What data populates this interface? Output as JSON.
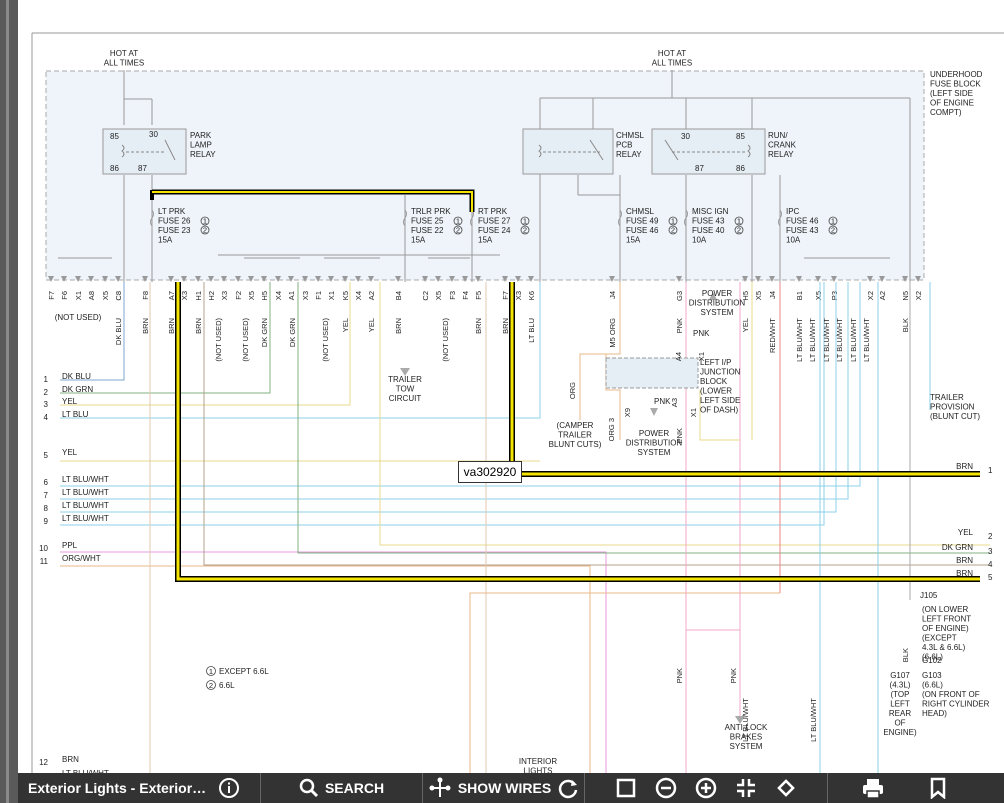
{
  "toolbar": {
    "title": "Exterior Lights - Exterior La...",
    "info_icon": "info-icon",
    "search_label": "SEARCH",
    "show_wires_label": "SHOW WIRES",
    "icons": [
      "search-icon",
      "wires-icon",
      "refresh-icon",
      "fit-icon",
      "zoom-out-icon",
      "zoom-in-icon",
      "collapse-icon",
      "rotate-icon",
      "print-icon",
      "bookmark-icon"
    ]
  },
  "callout": "va302920",
  "diagram": {
    "hot_left": "HOT AT\nALL TIMES",
    "hot_right": "HOT AT\nALL TIMES",
    "fuse_block": "UNDERHOOD\nFUSE BLOCK\n(LEFT SIDE\nOF ENGINE\nCOMPT)",
    "park_relay": "PARK\nLAMP\nRELAY",
    "chmsl_relay": "CHMSL\nPCB\nRELAY",
    "run_relay": "RUN/\nCRANK\nRELAY",
    "relay_pins_left": [
      "85",
      "30",
      "86",
      "87"
    ],
    "relay_pins_right": [
      "30",
      "85",
      "87",
      "86"
    ],
    "fuses": [
      {
        "name": "LT PRK",
        "a": "FUSE 26",
        "b": "FUSE 23",
        "amp": "15A"
      },
      {
        "name": "TRLR PRK",
        "a": "FUSE 25",
        "b": "FUSE 22",
        "amp": "15A"
      },
      {
        "name": "RT PRK",
        "a": "FUSE 27",
        "b": "FUSE 24",
        "amp": "15A"
      },
      {
        "name": "CHMSL",
        "a": "FUSE 49",
        "b": "FUSE 46",
        "amp": "15A"
      },
      {
        "name": "MISC IGN",
        "a": "FUSE 43",
        "b": "FUSE 40",
        "amp": "10A"
      },
      {
        "name": "IPC",
        "a": "FUSE 46",
        "b": "FUSE 43",
        "amp": "10A"
      }
    ],
    "pins": [
      "F7",
      "F6",
      "X1",
      "A8",
      "X5",
      "C8",
      "F8",
      "A7",
      "X3",
      "H1",
      "H2",
      "X3",
      "F2",
      "X5",
      "H5",
      "X4",
      "A1",
      "X3",
      "F1",
      "X1",
      "K5",
      "X4",
      "A2",
      "B4",
      "C2",
      "X5",
      "F3",
      "F4",
      "F5",
      "F7",
      "X3",
      "K6",
      "J4",
      "G3",
      "H5",
      "X5",
      "J4",
      "B1",
      "X5",
      "P3",
      "X2",
      "A2",
      "N5",
      "X2"
    ],
    "wire_colors_top": [
      "DK BLU",
      "BRN",
      "BRN",
      "BRN",
      "(NOT USED)",
      "(NOT USED)",
      "DK GRN",
      "DK GRN",
      "(NOT USED)",
      "YEL",
      "YEL",
      "BRN",
      "(NOT USED)",
      "BRN",
      "BRN",
      "LT BLU",
      "M5 ORG",
      "PNK",
      "YEL",
      "RED/WHT",
      "LT BLU/WHT",
      "LT BLU/WHT",
      "LT BLU/WHT",
      "LT BLU/WHT",
      "LT BLU/WHT",
      "LT BLU/WHT",
      "BLK"
    ],
    "not_used": "(NOT USED)",
    "trailer_tow": "TRAILER\nTOW\nCIRCUIT",
    "power_dist": "POWER\nDISTRIBUTION\nSYSTEM",
    "left_ip": "LEFT I/P\nJUNCTION\nBLOCK\n(LOWER\nLEFT SIDE\nOF DASH)",
    "camper": "(CAMPER\nTRAILER\nBLUNT CUTS)",
    "trailer_prov": "TRAILER\nPROVISION\n(BLUNT CUT)",
    "left_rows": [
      {
        "n": "1",
        "c": "DK BLU"
      },
      {
        "n": "2",
        "c": "DK GRN"
      },
      {
        "n": "3",
        "c": "YEL"
      },
      {
        "n": "4",
        "c": "LT BLU"
      },
      {
        "n": "5",
        "c": "YEL"
      },
      {
        "n": "6",
        "c": "LT BLU/WHT"
      },
      {
        "n": "7",
        "c": "LT BLU/WHT"
      },
      {
        "n": "8",
        "c": "LT BLU/WHT"
      },
      {
        "n": "9",
        "c": "LT BLU/WHT"
      },
      {
        "n": "10",
        "c": "PPL"
      },
      {
        "n": "11",
        "c": "ORG/WHT"
      },
      {
        "n": "12",
        "c": "BRN"
      }
    ],
    "row12_sub": "LT BLU/WHT",
    "right_rows": [
      {
        "n": "1",
        "c": "BRN"
      },
      {
        "n": "2",
        "c": "YEL"
      },
      {
        "n": "3",
        "c": "DK GRN"
      },
      {
        "n": "4",
        "c": "BRN"
      },
      {
        "n": "5",
        "c": "BRN"
      }
    ],
    "legend1": "EXCEPT 6.6L",
    "legend2": "6.6L",
    "j105": "J105",
    "j105_note": "(ON LOWER\nLEFT FRONT\nOF ENGINE)\n(EXCEPT\n4.3L & 6.6L)\n(6.6L)",
    "g102": "G102",
    "g107": "G107\n(4.3L)\n(TOP\nLEFT\nREAR\nOF\nENGINE)",
    "g103": "G103\n(6.6L)\n(ON FRONT OF\nRIGHT CYLINDER\nHEAD)",
    "abs": "ANTI-LOCK\nBRAKES\nSYSTEM",
    "interior": "INTERIOR\nLIGHTS",
    "pnk": "PNK",
    "org": "ORG",
    "blk": "BLK",
    "ltbluwht": "LT BLU/WHT",
    "pins_a4x1": [
      "A4",
      "X1"
    ],
    "pins_x9": [
      "ORG 3",
      "X9"
    ],
    "pins_a3x1": [
      "A3",
      "X1"
    ]
  }
}
